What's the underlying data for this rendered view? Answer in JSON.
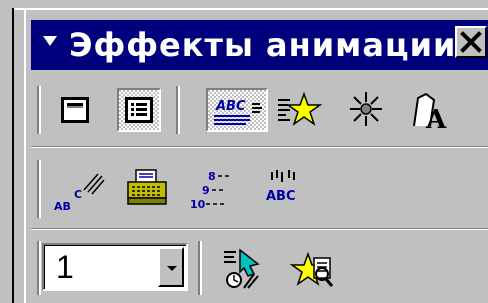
{
  "window": {
    "title": "Эффекты анимации",
    "close_icon": "close-x-icon"
  },
  "toolbar_row1": {
    "buttons": [
      {
        "name": "animate-title-button",
        "icon": "title-slide-icon",
        "pressed": false
      },
      {
        "name": "animate-text-button",
        "icon": "text-slide-icon",
        "pressed": true
      },
      {
        "name": "drive-in-effect-button",
        "icon": "drive-in-icon",
        "pressed": true
      },
      {
        "name": "flying-effect-button",
        "icon": "flying-star-icon",
        "pressed": false
      },
      {
        "name": "camera-effect-button",
        "icon": "camera-flash-icon",
        "pressed": false
      },
      {
        "name": "flash-once-effect-button",
        "icon": "flash-text-icon",
        "pressed": false
      }
    ]
  },
  "toolbar_row2": {
    "buttons": [
      {
        "name": "laser-text-effect-button",
        "icon": "laser-text-icon"
      },
      {
        "name": "typewriter-effect-button",
        "icon": "typewriter-icon"
      },
      {
        "name": "reverse-order-effect-button",
        "icon": "reverse-order-icon"
      },
      {
        "name": "drop-in-effect-button",
        "icon": "drop-in-icon"
      }
    ]
  },
  "toolbar_row3": {
    "order_combo": {
      "value": "1"
    },
    "buttons": [
      {
        "name": "custom-animation-button",
        "icon": "custom-animation-icon"
      },
      {
        "name": "animation-preview-button",
        "icon": "animation-preview-icon"
      }
    ]
  }
}
